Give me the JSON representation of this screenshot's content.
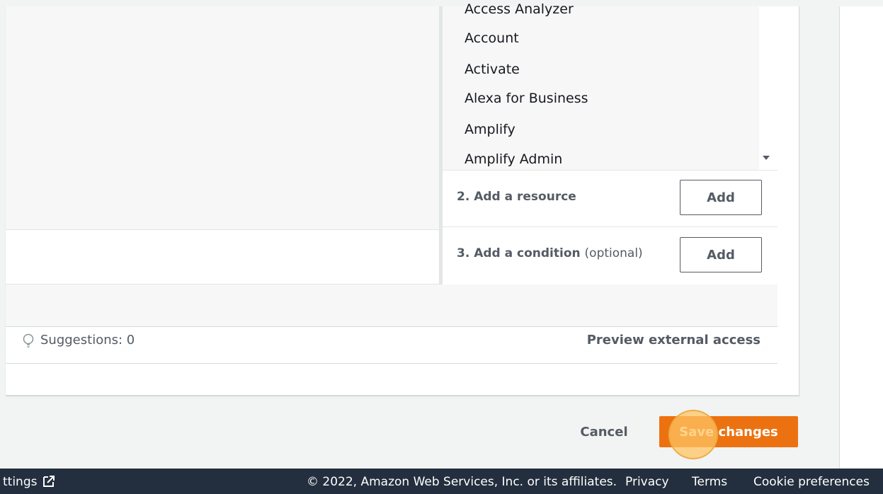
{
  "services": {
    "items": [
      "Access Analyzer",
      "Account",
      "Activate",
      "Alexa for Business",
      "Amplify",
      "Amplify Admin"
    ]
  },
  "steps": {
    "resource": {
      "label": "2. Add a resource",
      "button": "Add"
    },
    "condition": {
      "label": "3. Add a condition",
      "optional": "(optional)",
      "button": "Add"
    }
  },
  "status": {
    "suggestions": "Suggestions: 0",
    "preview_external_access": "Preview external access"
  },
  "actions": {
    "cancel": "Cancel",
    "save": "Save changes"
  },
  "footer": {
    "settings_partial": "ttings",
    "copyright": "© 2022, Amazon Web Services, Inc. or its affiliates.",
    "privacy": "Privacy",
    "terms": "Terms",
    "cookie_preferences": "Cookie preferences"
  },
  "colors": {
    "primary_button": "#ec7211",
    "footer_bg": "#232f3e"
  }
}
